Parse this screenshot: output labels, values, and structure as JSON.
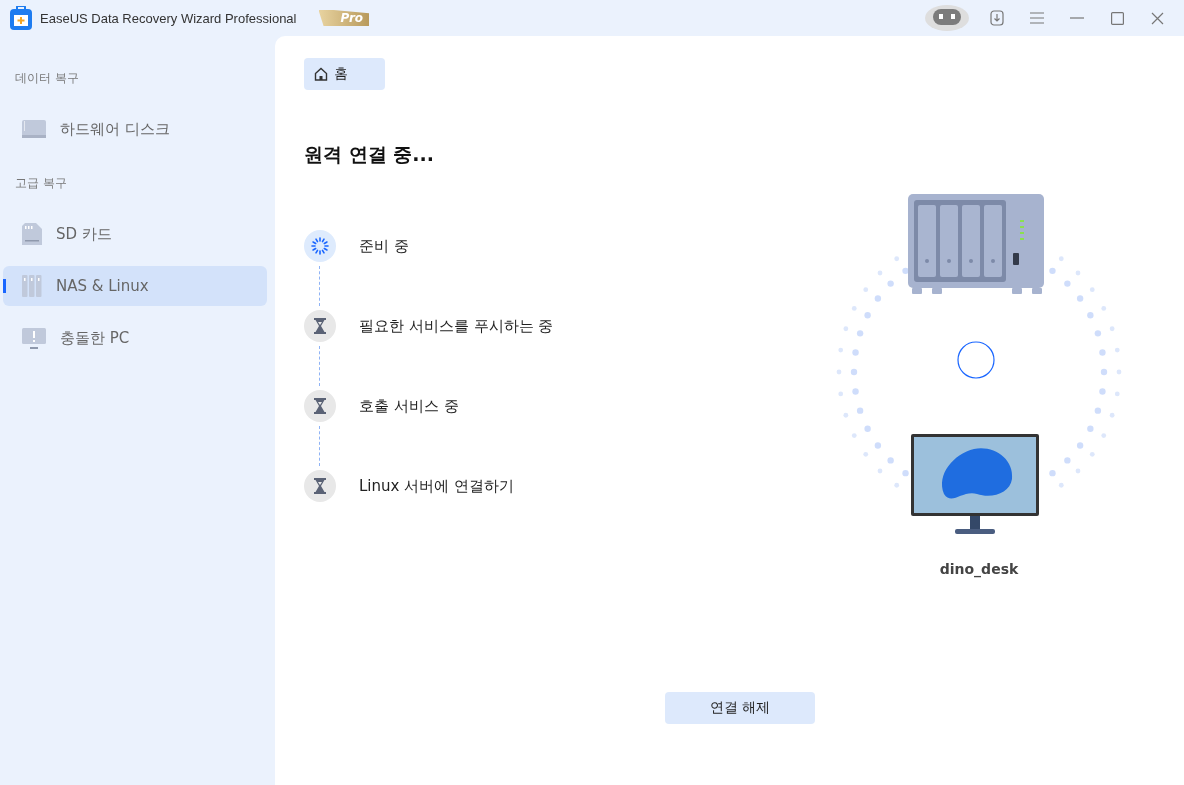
{
  "window": {
    "title": "EaseUS Data Recovery Wizard Professional",
    "badge": "Pro"
  },
  "sidebar": {
    "sections": [
      {
        "heading": "데이터 복구",
        "items": [
          {
            "label": "하드웨어 디스크",
            "kind": "disk",
            "selected": false
          }
        ]
      },
      {
        "heading": "고급 복구",
        "items": [
          {
            "label": "SD 카드",
            "kind": "sd",
            "selected": false
          },
          {
            "label": "NAS & Linux",
            "kind": "nas",
            "selected": true
          },
          {
            "label": "충돌한 PC",
            "kind": "crash",
            "selected": false
          }
        ]
      }
    ]
  },
  "breadcrumb": {
    "label": "홈"
  },
  "heading": "원격 연결 중...",
  "steps": [
    {
      "label": "준비 중",
      "kind": "active"
    },
    {
      "label": "필요한 서비스를 푸시하는 중",
      "kind": "pending"
    },
    {
      "label": "호출 서비스 중",
      "kind": "pending"
    },
    {
      "label": "Linux 서버에 연결하기",
      "kind": "pending"
    }
  ],
  "device": {
    "name": "dino_desk"
  },
  "disconnect_button": "연결 해제"
}
